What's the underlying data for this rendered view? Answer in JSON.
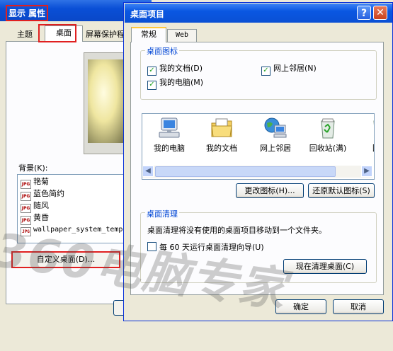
{
  "back_window": {
    "title": "显示 属性",
    "tabs": [
      "主题",
      "桌面",
      "屏幕保护程序"
    ],
    "active_tab": "桌面",
    "background_label": "背景(K):",
    "backgrounds": [
      "艳菊",
      "蓝色简约",
      "随风",
      "黄昏",
      "wallpaper_system_temp"
    ],
    "customize_button": "自定义桌面(D)..."
  },
  "dialog": {
    "title": "桌面项目",
    "help_glyph": "?",
    "close_glyph": "✕",
    "tabs": [
      "常规",
      "Web"
    ],
    "icons_group": {
      "title": "桌面图标",
      "checkboxes": [
        {
          "label": "我的文档(D)",
          "checked": true
        },
        {
          "label": "网上邻居(N)",
          "checked": true
        },
        {
          "label": "我的电脑(M)",
          "checked": true
        }
      ]
    },
    "desktop_icons": [
      {
        "label": "我的电脑",
        "icon": "my-computer-icon"
      },
      {
        "label": "我的文档",
        "icon": "my-documents-icon"
      },
      {
        "label": "网上邻居",
        "icon": "network-places-icon"
      },
      {
        "label": "回收站(满)",
        "icon": "recycle-bin-full-icon"
      },
      {
        "label": "回收",
        "icon": "recycle-bin-empty-icon"
      }
    ],
    "change_icon_button": "更改图标(H)...",
    "restore_default_button": "还原默认图标(S)",
    "cleanup_group": {
      "title": "桌面清理",
      "description": "桌面清理将没有使用的桌面项目移动到一个文件夹。",
      "checkbox": {
        "label": "每 60 天运行桌面清理向导(U)",
        "checked": false
      },
      "cleanup_now_button": "现在清理桌面(C)"
    },
    "ok_button": "确定",
    "cancel_button": "取消"
  },
  "watermark": "360电脑专家",
  "colors": {
    "title_blue": "#0a57e2",
    "highlight_red": "#e02020",
    "group_title": "#0046d5"
  }
}
